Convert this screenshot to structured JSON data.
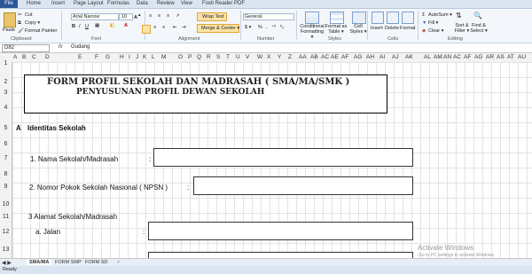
{
  "menu": {
    "file": "File",
    "tabs": [
      "Home",
      "Insert",
      "Page Layout",
      "Formulas",
      "Data",
      "Review",
      "View",
      "Foxit Reader PDF"
    ]
  },
  "ribbon": {
    "clipboard": {
      "paste": "Paste",
      "cut": "Cut",
      "copy": "Copy ▾",
      "format_painter": "Format Painter",
      "group": "Clipboard"
    },
    "font": {
      "name": "Arial Narrow",
      "size": "10",
      "group": "Font"
    },
    "alignment": {
      "wrap": "Wrap Text",
      "merge": "Merge & Center ▾",
      "group": "Alignment"
    },
    "number": {
      "format": "General",
      "group": "Number"
    },
    "styles": {
      "conditional": "Conditional Formatting ▾",
      "format_table": "Format as Table ▾",
      "cell_styles": "Cell Styles ▾",
      "group": "Styles"
    },
    "cells": {
      "insert": "Insert",
      "delete": "Delete",
      "format": "Format",
      "group": "Cells"
    },
    "editing": {
      "autosum": "AutoSum ▾",
      "fill": "Fill ▾",
      "clear": "Clear ▾",
      "sort": "Sort & Filter ▾",
      "find": "Find & Select ▾",
      "group": "Editing"
    }
  },
  "formula_bar": {
    "cell_ref": "D82",
    "fx": "fx",
    "value": "Gudang"
  },
  "columns": [
    "A",
    "B",
    "C",
    "D",
    "E",
    "F",
    "G",
    "H",
    "I",
    "J",
    "K",
    "L",
    "M",
    "O",
    "P",
    "Q",
    "R",
    "S",
    "T",
    "U",
    "V",
    "W",
    "X",
    "Y",
    "Z",
    "AA",
    "AB",
    "AC",
    "AE",
    "AF",
    "AG",
    "AH",
    "AI",
    "AJ",
    "AK",
    "AL",
    "AM",
    "AN",
    "AC",
    "AF",
    "AG",
    "AR",
    "AS",
    "AT",
    "AU"
  ],
  "rows": [
    "1",
    "2",
    "3",
    "4",
    "5",
    "6",
    "7",
    "8",
    "9",
    "10",
    "11",
    "12",
    "13"
  ],
  "sheet": {
    "title1": "FORM PROFIL SEKOLAH DAN MADRASAH ( SMA/MA/SMK )",
    "title2": "PENYUSUNAN PROFIL DEWAN SEKOLAH",
    "section_letter": "A",
    "section_title": "Identitas Sekolah",
    "item1": "1.  Nama Sekolah/Madrasah",
    "item2": "2.  Nomor Pokok Sekolah Nasional ( NPSN )",
    "item3": "3  Alamat Sekolah/Madrasah",
    "item3a": "a.  Jalan",
    "colon": ":"
  },
  "sheet_tabs": [
    "SMA/MA",
    "FORM SMP",
    "FORM SD"
  ],
  "status": {
    "ready": "Ready"
  },
  "watermark": {
    "line1": "Activate Windows",
    "line2": "Go to PC settings to activate Windows."
  }
}
